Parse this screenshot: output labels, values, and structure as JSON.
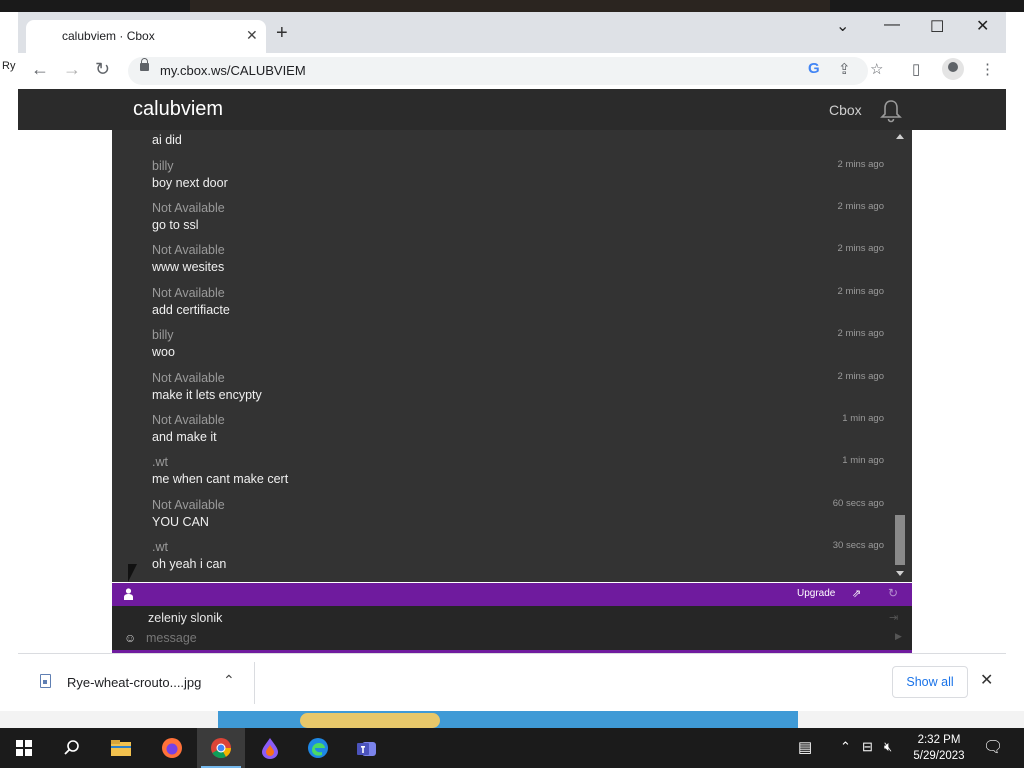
{
  "browser": {
    "tab_title": "calubviem · Cbox",
    "tab_close": "✕",
    "new_tab": "+",
    "url": "my.cbox.ws/CALUBVIEM"
  },
  "site": {
    "title": "calubviem",
    "nav_link": "Cbox"
  },
  "chat": {
    "first_text": "ai did",
    "messages": [
      {
        "name": "billy",
        "text": "boy next door",
        "time": "2 mins ago"
      },
      {
        "name": "Not Available",
        "text": "go to ssl",
        "time": "2 mins ago"
      },
      {
        "name": "Not Available",
        "text": "www wesites",
        "time": "2 mins ago"
      },
      {
        "name": "Not Available",
        "text": "add certifiacte",
        "time": "2 mins ago"
      },
      {
        "name": "billy",
        "text": "woo",
        "time": "2 mins ago"
      },
      {
        "name": "Not Available",
        "text": "make it lets encypty",
        "time": "2 mins ago"
      },
      {
        "name": "Not Available",
        "text": "and make it",
        "time": "1 min ago"
      },
      {
        "name": ".wt",
        "text": "me when cant make cert",
        "time": "1 min ago"
      },
      {
        "name": "Not Available",
        "text": "YOU CAN",
        "time": "60 secs ago"
      },
      {
        "name": ".wt",
        "text": "oh yeah i can",
        "time": "30 secs ago"
      }
    ]
  },
  "toolbar": {
    "upgrade_label": "Upgrade"
  },
  "composer": {
    "username": "zeleniy slonik",
    "placeholder": "message"
  },
  "downloads": {
    "file_name": "Rye-wheat-crouto....jpg",
    "show_all": "Show all"
  },
  "taskbar": {
    "time": "2:32 PM",
    "date": "5/29/2023"
  },
  "desktop": {
    "left_edge_text": "Ry"
  },
  "colors": {
    "cbox_accent": "#6f1b9e",
    "chat_bg": "#333333",
    "header_bg": "#2b2b2b"
  }
}
